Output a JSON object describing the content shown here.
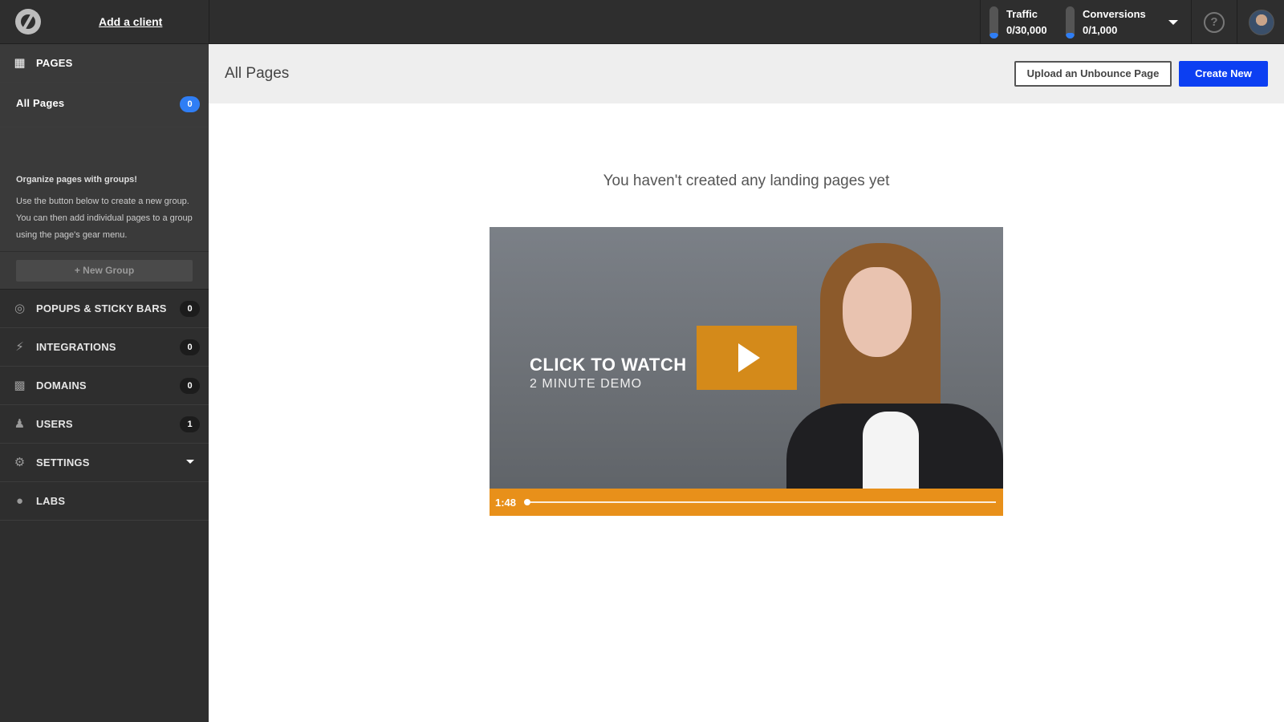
{
  "topbar": {
    "add_client": "Add a client",
    "traffic_label": "Traffic",
    "traffic_value": "0/30,000",
    "conversions_label": "Conversions",
    "conversions_value": "0/1,000",
    "help": "?"
  },
  "sidebar": {
    "pages_label": "PAGES",
    "all_pages_label": "All Pages",
    "all_pages_count": "0",
    "organize_title": "Organize pages with groups!",
    "organize_text": "Use the button below to create a new group. You can then add individual pages to a group using the page's gear menu.",
    "new_group": "+ New Group",
    "items": [
      {
        "label": "POPUPS & STICKY BARS",
        "count": "0"
      },
      {
        "label": "INTEGRATIONS",
        "count": "0"
      },
      {
        "label": "DOMAINS",
        "count": "0"
      },
      {
        "label": "USERS",
        "count": "1"
      },
      {
        "label": "SETTINGS"
      },
      {
        "label": "LABS"
      }
    ]
  },
  "main": {
    "title": "All Pages",
    "upload_button": "Upload an Unbounce Page",
    "create_button": "Create New",
    "empty_message": "You haven't created any landing pages yet",
    "video": {
      "title": "CLICK TO WATCH",
      "subtitle": "2 MINUTE DEMO",
      "time": "1:48"
    }
  },
  "colors": {
    "accent_blue": "#0c3ff2",
    "badge_blue": "#2f7ef5",
    "video_orange": "#e8901a"
  }
}
